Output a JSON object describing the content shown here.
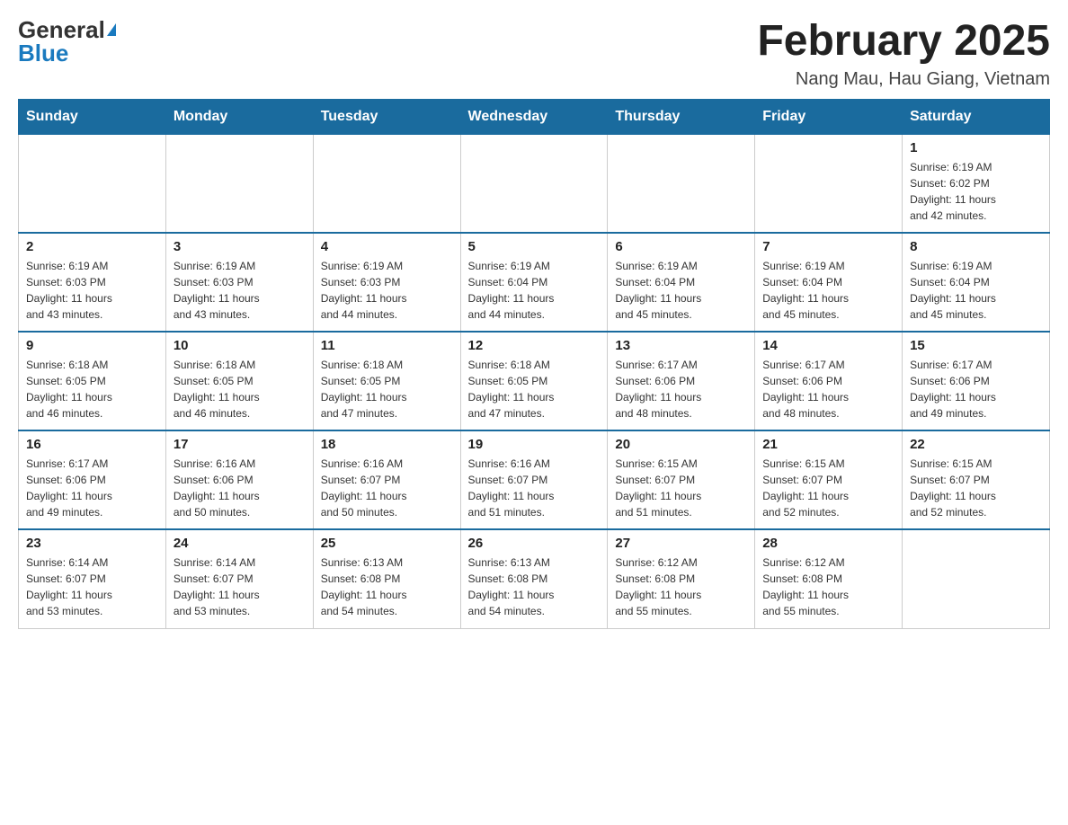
{
  "header": {
    "logo_general": "General",
    "logo_blue": "Blue",
    "month_title": "February 2025",
    "location": "Nang Mau, Hau Giang, Vietnam"
  },
  "days_of_week": [
    "Sunday",
    "Monday",
    "Tuesday",
    "Wednesday",
    "Thursday",
    "Friday",
    "Saturday"
  ],
  "weeks": [
    {
      "days": [
        {
          "num": "",
          "info": ""
        },
        {
          "num": "",
          "info": ""
        },
        {
          "num": "",
          "info": ""
        },
        {
          "num": "",
          "info": ""
        },
        {
          "num": "",
          "info": ""
        },
        {
          "num": "",
          "info": ""
        },
        {
          "num": "1",
          "info": "Sunrise: 6:19 AM\nSunset: 6:02 PM\nDaylight: 11 hours\nand 42 minutes."
        }
      ]
    },
    {
      "days": [
        {
          "num": "2",
          "info": "Sunrise: 6:19 AM\nSunset: 6:03 PM\nDaylight: 11 hours\nand 43 minutes."
        },
        {
          "num": "3",
          "info": "Sunrise: 6:19 AM\nSunset: 6:03 PM\nDaylight: 11 hours\nand 43 minutes."
        },
        {
          "num": "4",
          "info": "Sunrise: 6:19 AM\nSunset: 6:03 PM\nDaylight: 11 hours\nand 44 minutes."
        },
        {
          "num": "5",
          "info": "Sunrise: 6:19 AM\nSunset: 6:04 PM\nDaylight: 11 hours\nand 44 minutes."
        },
        {
          "num": "6",
          "info": "Sunrise: 6:19 AM\nSunset: 6:04 PM\nDaylight: 11 hours\nand 45 minutes."
        },
        {
          "num": "7",
          "info": "Sunrise: 6:19 AM\nSunset: 6:04 PM\nDaylight: 11 hours\nand 45 minutes."
        },
        {
          "num": "8",
          "info": "Sunrise: 6:19 AM\nSunset: 6:04 PM\nDaylight: 11 hours\nand 45 minutes."
        }
      ]
    },
    {
      "days": [
        {
          "num": "9",
          "info": "Sunrise: 6:18 AM\nSunset: 6:05 PM\nDaylight: 11 hours\nand 46 minutes."
        },
        {
          "num": "10",
          "info": "Sunrise: 6:18 AM\nSunset: 6:05 PM\nDaylight: 11 hours\nand 46 minutes."
        },
        {
          "num": "11",
          "info": "Sunrise: 6:18 AM\nSunset: 6:05 PM\nDaylight: 11 hours\nand 47 minutes."
        },
        {
          "num": "12",
          "info": "Sunrise: 6:18 AM\nSunset: 6:05 PM\nDaylight: 11 hours\nand 47 minutes."
        },
        {
          "num": "13",
          "info": "Sunrise: 6:17 AM\nSunset: 6:06 PM\nDaylight: 11 hours\nand 48 minutes."
        },
        {
          "num": "14",
          "info": "Sunrise: 6:17 AM\nSunset: 6:06 PM\nDaylight: 11 hours\nand 48 minutes."
        },
        {
          "num": "15",
          "info": "Sunrise: 6:17 AM\nSunset: 6:06 PM\nDaylight: 11 hours\nand 49 minutes."
        }
      ]
    },
    {
      "days": [
        {
          "num": "16",
          "info": "Sunrise: 6:17 AM\nSunset: 6:06 PM\nDaylight: 11 hours\nand 49 minutes."
        },
        {
          "num": "17",
          "info": "Sunrise: 6:16 AM\nSunset: 6:06 PM\nDaylight: 11 hours\nand 50 minutes."
        },
        {
          "num": "18",
          "info": "Sunrise: 6:16 AM\nSunset: 6:07 PM\nDaylight: 11 hours\nand 50 minutes."
        },
        {
          "num": "19",
          "info": "Sunrise: 6:16 AM\nSunset: 6:07 PM\nDaylight: 11 hours\nand 51 minutes."
        },
        {
          "num": "20",
          "info": "Sunrise: 6:15 AM\nSunset: 6:07 PM\nDaylight: 11 hours\nand 51 minutes."
        },
        {
          "num": "21",
          "info": "Sunrise: 6:15 AM\nSunset: 6:07 PM\nDaylight: 11 hours\nand 52 minutes."
        },
        {
          "num": "22",
          "info": "Sunrise: 6:15 AM\nSunset: 6:07 PM\nDaylight: 11 hours\nand 52 minutes."
        }
      ]
    },
    {
      "days": [
        {
          "num": "23",
          "info": "Sunrise: 6:14 AM\nSunset: 6:07 PM\nDaylight: 11 hours\nand 53 minutes."
        },
        {
          "num": "24",
          "info": "Sunrise: 6:14 AM\nSunset: 6:07 PM\nDaylight: 11 hours\nand 53 minutes."
        },
        {
          "num": "25",
          "info": "Sunrise: 6:13 AM\nSunset: 6:08 PM\nDaylight: 11 hours\nand 54 minutes."
        },
        {
          "num": "26",
          "info": "Sunrise: 6:13 AM\nSunset: 6:08 PM\nDaylight: 11 hours\nand 54 minutes."
        },
        {
          "num": "27",
          "info": "Sunrise: 6:12 AM\nSunset: 6:08 PM\nDaylight: 11 hours\nand 55 minutes."
        },
        {
          "num": "28",
          "info": "Sunrise: 6:12 AM\nSunset: 6:08 PM\nDaylight: 11 hours\nand 55 minutes."
        },
        {
          "num": "",
          "info": ""
        }
      ]
    }
  ]
}
